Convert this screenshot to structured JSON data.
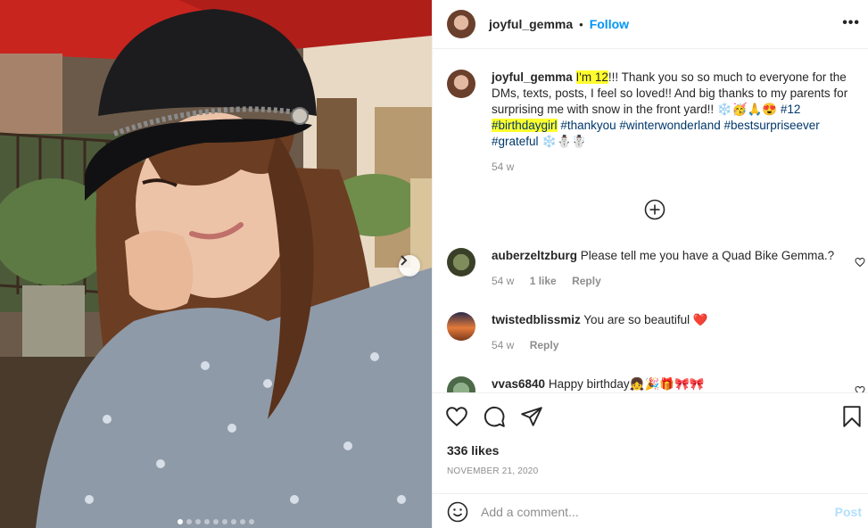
{
  "post": {
    "username": "joyful_gemma",
    "separator": "•",
    "follow_label": "Follow",
    "more_label": "•••"
  },
  "caption": {
    "username": "joyful_gemma",
    "highlight": "I'm 12",
    "text1": "!!! Thank you so so much to everyone for the DMs, texts, posts, I feel so loved!! And big thanks to my parents for surprising me with snow in the front yard!! ",
    "emojis1": "❄️🥳🙏😍 ",
    "tag1": "#12",
    "tag2": "#birthdaygirl",
    "tag3": "#thankyou",
    "tag4": "#winterwonderland",
    "tag5": "#bestsurpriseever",
    "tag6": "#grateful",
    "emojis2": "❄️⛄☃️",
    "time": "54 w"
  },
  "comments": [
    {
      "user": "auberzeltzburg",
      "text": "Please tell me you have a Quad Bike Gemma.?",
      "time": "54 w",
      "likes": "1 like",
      "reply": "Reply"
    },
    {
      "user": "twistedblissmiz",
      "text": "You are so beautiful ",
      "emoji": "❤️",
      "time": "54 w",
      "reply": "Reply"
    },
    {
      "user": "vvas6840",
      "text": "Happy birthday",
      "emoji": "👧🎉🎁🎀🎀"
    }
  ],
  "footer": {
    "likes": "336 likes",
    "date": "NOVEMBER 21, 2020",
    "comment_placeholder": "Add a comment...",
    "post_label": "Post"
  },
  "carousel": {
    "slides": 9,
    "active": 0
  }
}
